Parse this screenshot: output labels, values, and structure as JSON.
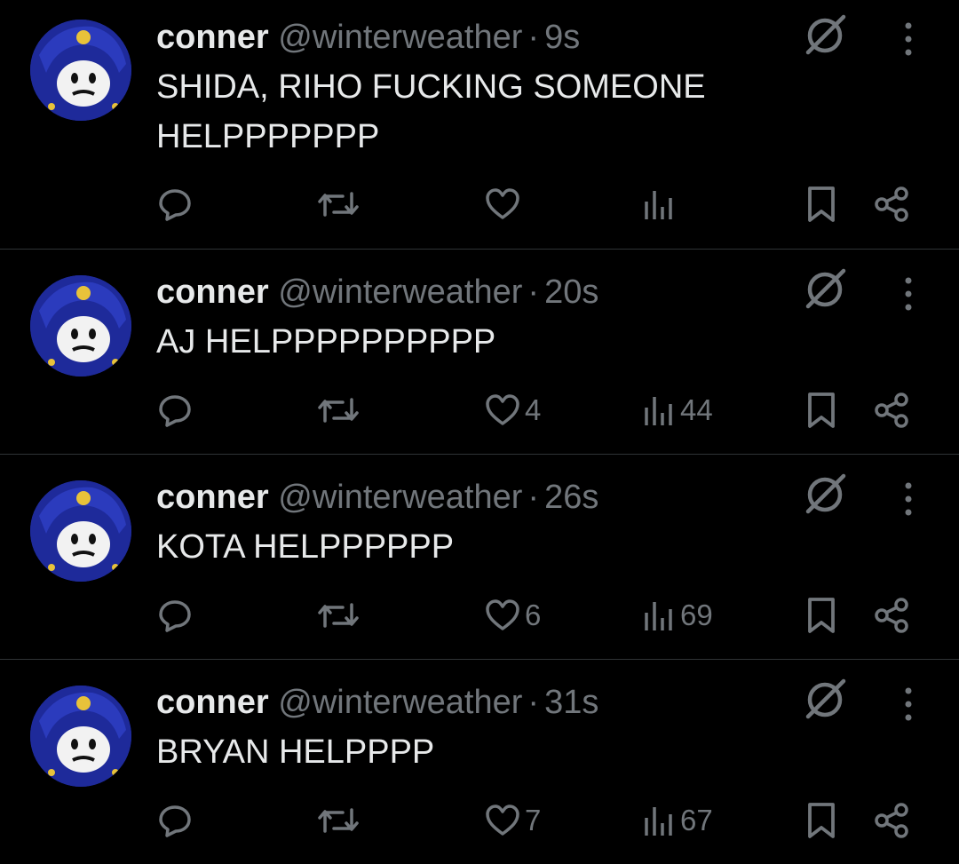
{
  "colors": {
    "background": "#000000",
    "primary_text": "#e7e9ea",
    "secondary_text": "#71767b",
    "divider": "#2f3336",
    "avatar_bg": "#1e2a9a"
  },
  "icons": {
    "no_sign": "prohibited-circle-icon",
    "more": "vertical-ellipsis-icon",
    "reply": "speech-bubble-icon",
    "retweet": "retweet-arrows-icon",
    "like": "heart-icon",
    "views": "bar-chart-icon",
    "bookmark": "bookmark-icon",
    "share": "share-nodes-icon"
  },
  "tweets": [
    {
      "name": "conner",
      "handle": "@winterweather",
      "separator": "·",
      "time": "9s",
      "text": "SHIDA, RIHO FUCKING SOMEONE\nHELPPPPPPP",
      "likes": "",
      "views": ""
    },
    {
      "name": "conner",
      "handle": "@winterweather",
      "separator": "·",
      "time": "20s",
      "text": "AJ HELPPPPPPPPPP",
      "likes": "4",
      "views": "44"
    },
    {
      "name": "conner",
      "handle": "@winterweather",
      "separator": "·",
      "time": "26s",
      "text": "KOTA HELPPPPPP",
      "likes": "6",
      "views": "69"
    },
    {
      "name": "conner",
      "handle": "@winterweather",
      "separator": "·",
      "time": "31s",
      "text": "BRYAN HELPPPP",
      "likes": "7",
      "views": "67"
    }
  ]
}
